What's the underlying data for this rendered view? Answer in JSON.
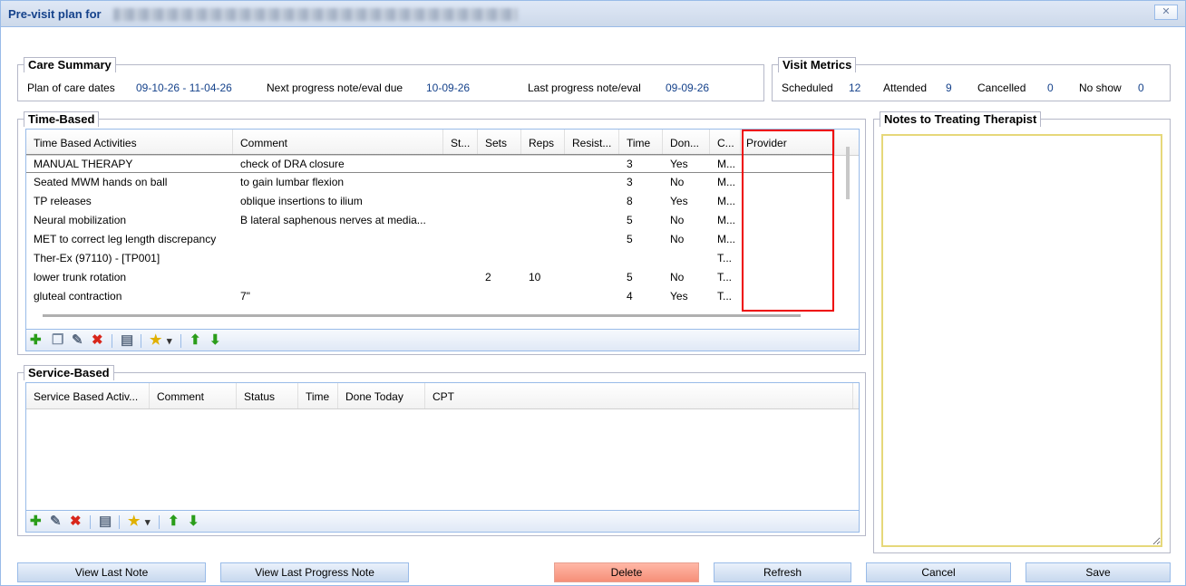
{
  "window": {
    "title": "Pre-visit plan for",
    "close_glyph": "✕"
  },
  "care_summary": {
    "legend": "Care Summary",
    "plan_label": "Plan of care dates",
    "plan_value": "09-10-26 - 11-04-26",
    "next_label": "Next progress note/eval due",
    "next_value": "10-09-26",
    "last_label": "Last progress note/eval",
    "last_value": "09-09-26"
  },
  "visit_metrics": {
    "legend": "Visit Metrics",
    "scheduled_label": "Scheduled",
    "scheduled_value": "12",
    "attended_label": "Attended",
    "attended_value": "9",
    "cancelled_label": "Cancelled",
    "cancelled_value": "0",
    "noshow_label": "No show",
    "noshow_value": "0"
  },
  "time_based": {
    "legend": "Time-Based",
    "columns": [
      "Time Based Activities",
      "Comment",
      "St...",
      "Sets",
      "Reps",
      "Resist...",
      "Time",
      "Don...",
      "C...",
      "Provider"
    ],
    "rows": [
      {
        "activity": "MANUAL THERAPY",
        "comment": "check of DRA closure",
        "st": "",
        "sets": "",
        "reps": "",
        "resist": "",
        "time": "3",
        "done": "Yes",
        "c": "M...",
        "provider": ""
      },
      {
        "activity": "Seated MWM hands on ball",
        "comment": "to gain lumbar flexion",
        "st": "",
        "sets": "",
        "reps": "",
        "resist": "",
        "time": "3",
        "done": "No",
        "c": "M...",
        "provider": ""
      },
      {
        "activity": "TP releases",
        "comment": "oblique insertions to ilium",
        "st": "",
        "sets": "",
        "reps": "",
        "resist": "",
        "time": "8",
        "done": "Yes",
        "c": "M...",
        "provider": ""
      },
      {
        "activity": "Neural  mobilization",
        "comment": "B lateral saphenous nerves at media...",
        "st": "",
        "sets": "",
        "reps": "",
        "resist": "",
        "time": "5",
        "done": "No",
        "c": "M...",
        "provider": ""
      },
      {
        "activity": "MET to correct leg length discrepancy",
        "comment": "",
        "st": "",
        "sets": "",
        "reps": "",
        "resist": "",
        "time": "5",
        "done": "No",
        "c": "M...",
        "provider": ""
      },
      {
        "activity": "Ther-Ex (97110) - [TP001]",
        "comment": "",
        "st": "",
        "sets": "",
        "reps": "",
        "resist": "",
        "time": "",
        "done": "",
        "c": "T...",
        "provider": ""
      },
      {
        "activity": "lower trunk rotation",
        "comment": "",
        "st": "",
        "sets": "2",
        "reps": "10",
        "resist": "",
        "time": "5",
        "done": "No",
        "c": "T...",
        "provider": ""
      },
      {
        "activity": "gluteal contraction",
        "comment": "7\"",
        "st": "",
        "sets": "",
        "reps": "",
        "resist": "",
        "time": "4",
        "done": "Yes",
        "c": "T...",
        "provider": ""
      }
    ]
  },
  "service_based": {
    "legend": "Service-Based",
    "columns": [
      "Service Based Activ...",
      "Comment",
      "Status",
      "Time",
      "Done Today",
      "CPT"
    ]
  },
  "notes": {
    "legend": "Notes to Treating Therapist",
    "value": ""
  },
  "toolbar_icons": {
    "add": "✚",
    "copy": "❐",
    "edit": "✎",
    "delete": "✖",
    "note": "▤",
    "star": "★",
    "caret": "▾",
    "up": "⬆",
    "down": "⬇"
  },
  "colors": {
    "accent": "#15428b",
    "add": "#2a9d1a",
    "delete": "#d8261b",
    "star": "#e0b000",
    "arrow": "#2a9d1a",
    "highlight": "#e00000"
  },
  "buttons": {
    "view_last_note": "View Last Note",
    "view_last_progress_note": "View Last Progress Note",
    "delete": "Delete",
    "refresh": "Refresh",
    "cancel": "Cancel",
    "save": "Save"
  }
}
